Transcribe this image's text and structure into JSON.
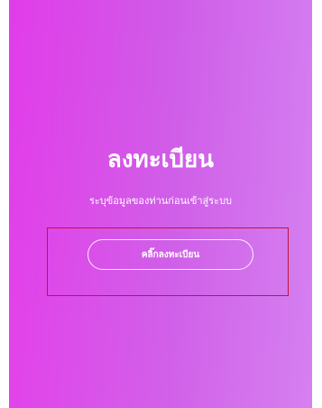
{
  "register_panel": {
    "title": "ลงทะเบียน",
    "subtitle": "ระบุข้อมูลของท่านก่อนเข้าสู่ระบบ",
    "button_label": "คลิ๊กลงทะเบียน"
  },
  "colors": {
    "gradient_start": "#e13ce9",
    "gradient_end": "#d47bf0",
    "highlight_outline": "#c0143c",
    "text": "#ffffff"
  }
}
